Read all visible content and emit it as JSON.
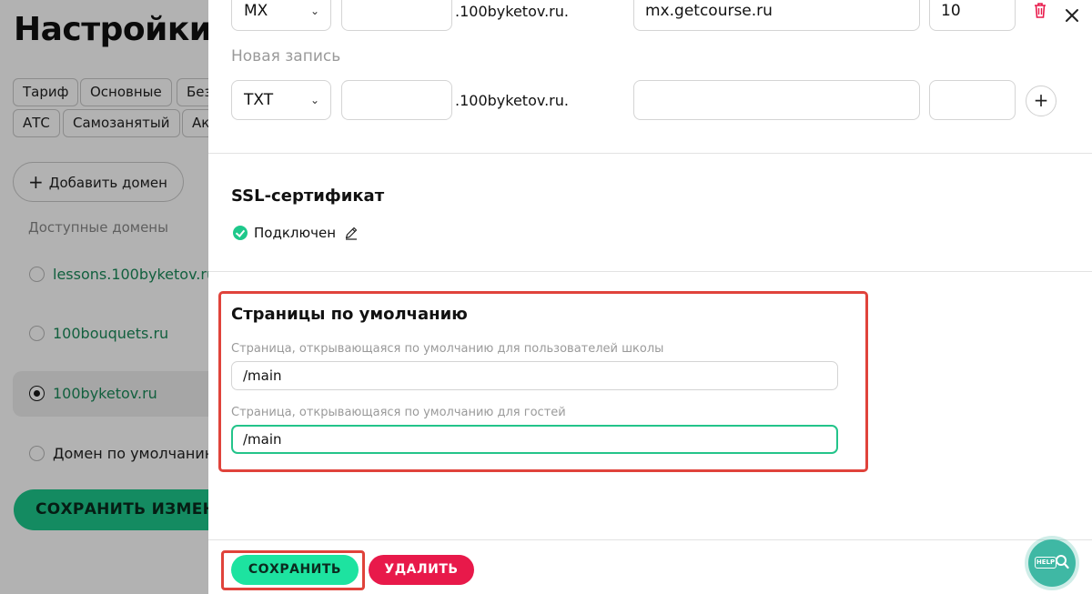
{
  "background": {
    "page_title": "Настройки п",
    "tabs_row1": [
      "Тариф",
      "Основные",
      "Без"
    ],
    "tabs_row2": [
      "АТС",
      "Самозанятый",
      "Ак"
    ],
    "add_domain_label": "Добавить домен",
    "available_domains_label": "Доступные домены",
    "domains": [
      {
        "name": "lessons.100byketov.ru",
        "selected": false
      },
      {
        "name": "100bouquets.ru",
        "selected": false
      },
      {
        "name": "100byketov.ru",
        "selected": true
      }
    ],
    "default_domain_label": "Домен по умолчанию",
    "save_changes_label": "СОХРАНИТЬ ИЗМЕН"
  },
  "dns_records": {
    "existing": {
      "type": "MX",
      "host": "",
      "domain_suffix": ".100byketov.ru.",
      "value": "mx.getcourse.ru",
      "priority": "10"
    },
    "new_record_heading": "Новая запись",
    "new": {
      "type": "TXT",
      "host": "",
      "domain_suffix": ".100byketov.ru.",
      "value": "",
      "priority": ""
    }
  },
  "ssl": {
    "heading": "SSL-сертификат",
    "status": "Подключен"
  },
  "default_pages": {
    "heading": "Страницы по умолчанию",
    "users_label": "Страница, открывающаяся по умолчанию для пользователей школы",
    "users_value": "/main",
    "guests_label": "Страница, открывающаяся по умолчанию для гостей",
    "guests_value": "/main"
  },
  "footer": {
    "save_label": "СОХРАНИТЬ",
    "delete_label": "УДАЛИТЬ",
    "help_label": "HELP"
  },
  "colors": {
    "accent_green": "#1de3a0",
    "danger_red": "#e8194a",
    "highlight_red": "#e0433b",
    "help_teal": "#3fb8a4"
  },
  "icons": [
    "trash-icon",
    "close-icon",
    "plus-icon",
    "check-circle-icon",
    "pencil-icon",
    "help-search-icon",
    "chevron-down-icon"
  ]
}
